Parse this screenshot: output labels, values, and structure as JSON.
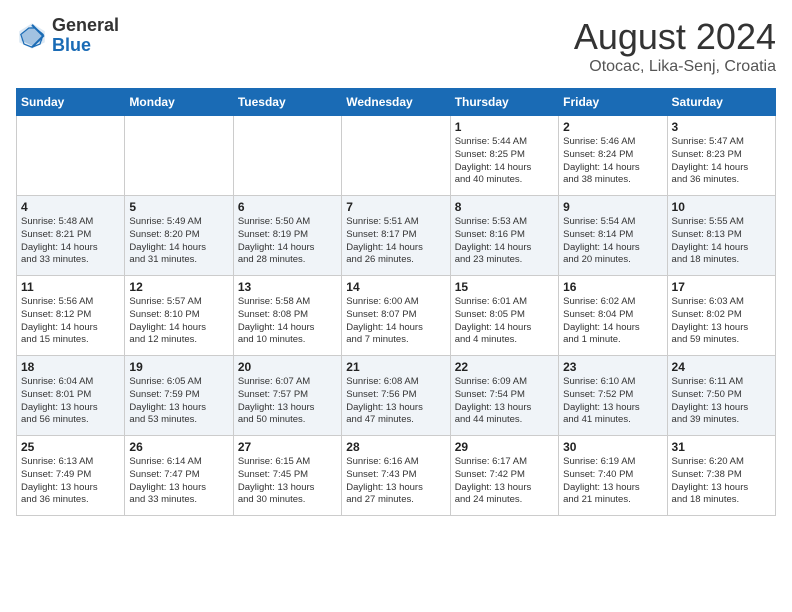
{
  "logo": {
    "general": "General",
    "blue": "Blue"
  },
  "title": "August 2024",
  "subtitle": "Otocac, Lika-Senj, Croatia",
  "days_of_week": [
    "Sunday",
    "Monday",
    "Tuesday",
    "Wednesday",
    "Thursday",
    "Friday",
    "Saturday"
  ],
  "weeks": [
    [
      {
        "day": "",
        "content": ""
      },
      {
        "day": "",
        "content": ""
      },
      {
        "day": "",
        "content": ""
      },
      {
        "day": "",
        "content": ""
      },
      {
        "day": "1",
        "content": "Sunrise: 5:44 AM\nSunset: 8:25 PM\nDaylight: 14 hours\nand 40 minutes."
      },
      {
        "day": "2",
        "content": "Sunrise: 5:46 AM\nSunset: 8:24 PM\nDaylight: 14 hours\nand 38 minutes."
      },
      {
        "day": "3",
        "content": "Sunrise: 5:47 AM\nSunset: 8:23 PM\nDaylight: 14 hours\nand 36 minutes."
      }
    ],
    [
      {
        "day": "4",
        "content": "Sunrise: 5:48 AM\nSunset: 8:21 PM\nDaylight: 14 hours\nand 33 minutes."
      },
      {
        "day": "5",
        "content": "Sunrise: 5:49 AM\nSunset: 8:20 PM\nDaylight: 14 hours\nand 31 minutes."
      },
      {
        "day": "6",
        "content": "Sunrise: 5:50 AM\nSunset: 8:19 PM\nDaylight: 14 hours\nand 28 minutes."
      },
      {
        "day": "7",
        "content": "Sunrise: 5:51 AM\nSunset: 8:17 PM\nDaylight: 14 hours\nand 26 minutes."
      },
      {
        "day": "8",
        "content": "Sunrise: 5:53 AM\nSunset: 8:16 PM\nDaylight: 14 hours\nand 23 minutes."
      },
      {
        "day": "9",
        "content": "Sunrise: 5:54 AM\nSunset: 8:14 PM\nDaylight: 14 hours\nand 20 minutes."
      },
      {
        "day": "10",
        "content": "Sunrise: 5:55 AM\nSunset: 8:13 PM\nDaylight: 14 hours\nand 18 minutes."
      }
    ],
    [
      {
        "day": "11",
        "content": "Sunrise: 5:56 AM\nSunset: 8:12 PM\nDaylight: 14 hours\nand 15 minutes."
      },
      {
        "day": "12",
        "content": "Sunrise: 5:57 AM\nSunset: 8:10 PM\nDaylight: 14 hours\nand 12 minutes."
      },
      {
        "day": "13",
        "content": "Sunrise: 5:58 AM\nSunset: 8:08 PM\nDaylight: 14 hours\nand 10 minutes."
      },
      {
        "day": "14",
        "content": "Sunrise: 6:00 AM\nSunset: 8:07 PM\nDaylight: 14 hours\nand 7 minutes."
      },
      {
        "day": "15",
        "content": "Sunrise: 6:01 AM\nSunset: 8:05 PM\nDaylight: 14 hours\nand 4 minutes."
      },
      {
        "day": "16",
        "content": "Sunrise: 6:02 AM\nSunset: 8:04 PM\nDaylight: 14 hours\nand 1 minute."
      },
      {
        "day": "17",
        "content": "Sunrise: 6:03 AM\nSunset: 8:02 PM\nDaylight: 13 hours\nand 59 minutes."
      }
    ],
    [
      {
        "day": "18",
        "content": "Sunrise: 6:04 AM\nSunset: 8:01 PM\nDaylight: 13 hours\nand 56 minutes."
      },
      {
        "day": "19",
        "content": "Sunrise: 6:05 AM\nSunset: 7:59 PM\nDaylight: 13 hours\nand 53 minutes."
      },
      {
        "day": "20",
        "content": "Sunrise: 6:07 AM\nSunset: 7:57 PM\nDaylight: 13 hours\nand 50 minutes."
      },
      {
        "day": "21",
        "content": "Sunrise: 6:08 AM\nSunset: 7:56 PM\nDaylight: 13 hours\nand 47 minutes."
      },
      {
        "day": "22",
        "content": "Sunrise: 6:09 AM\nSunset: 7:54 PM\nDaylight: 13 hours\nand 44 minutes."
      },
      {
        "day": "23",
        "content": "Sunrise: 6:10 AM\nSunset: 7:52 PM\nDaylight: 13 hours\nand 41 minutes."
      },
      {
        "day": "24",
        "content": "Sunrise: 6:11 AM\nSunset: 7:50 PM\nDaylight: 13 hours\nand 39 minutes."
      }
    ],
    [
      {
        "day": "25",
        "content": "Sunrise: 6:13 AM\nSunset: 7:49 PM\nDaylight: 13 hours\nand 36 minutes."
      },
      {
        "day": "26",
        "content": "Sunrise: 6:14 AM\nSunset: 7:47 PM\nDaylight: 13 hours\nand 33 minutes."
      },
      {
        "day": "27",
        "content": "Sunrise: 6:15 AM\nSunset: 7:45 PM\nDaylight: 13 hours\nand 30 minutes."
      },
      {
        "day": "28",
        "content": "Sunrise: 6:16 AM\nSunset: 7:43 PM\nDaylight: 13 hours\nand 27 minutes."
      },
      {
        "day": "29",
        "content": "Sunrise: 6:17 AM\nSunset: 7:42 PM\nDaylight: 13 hours\nand 24 minutes."
      },
      {
        "day": "30",
        "content": "Sunrise: 6:19 AM\nSunset: 7:40 PM\nDaylight: 13 hours\nand 21 minutes."
      },
      {
        "day": "31",
        "content": "Sunrise: 6:20 AM\nSunset: 7:38 PM\nDaylight: 13 hours\nand 18 minutes."
      }
    ]
  ]
}
